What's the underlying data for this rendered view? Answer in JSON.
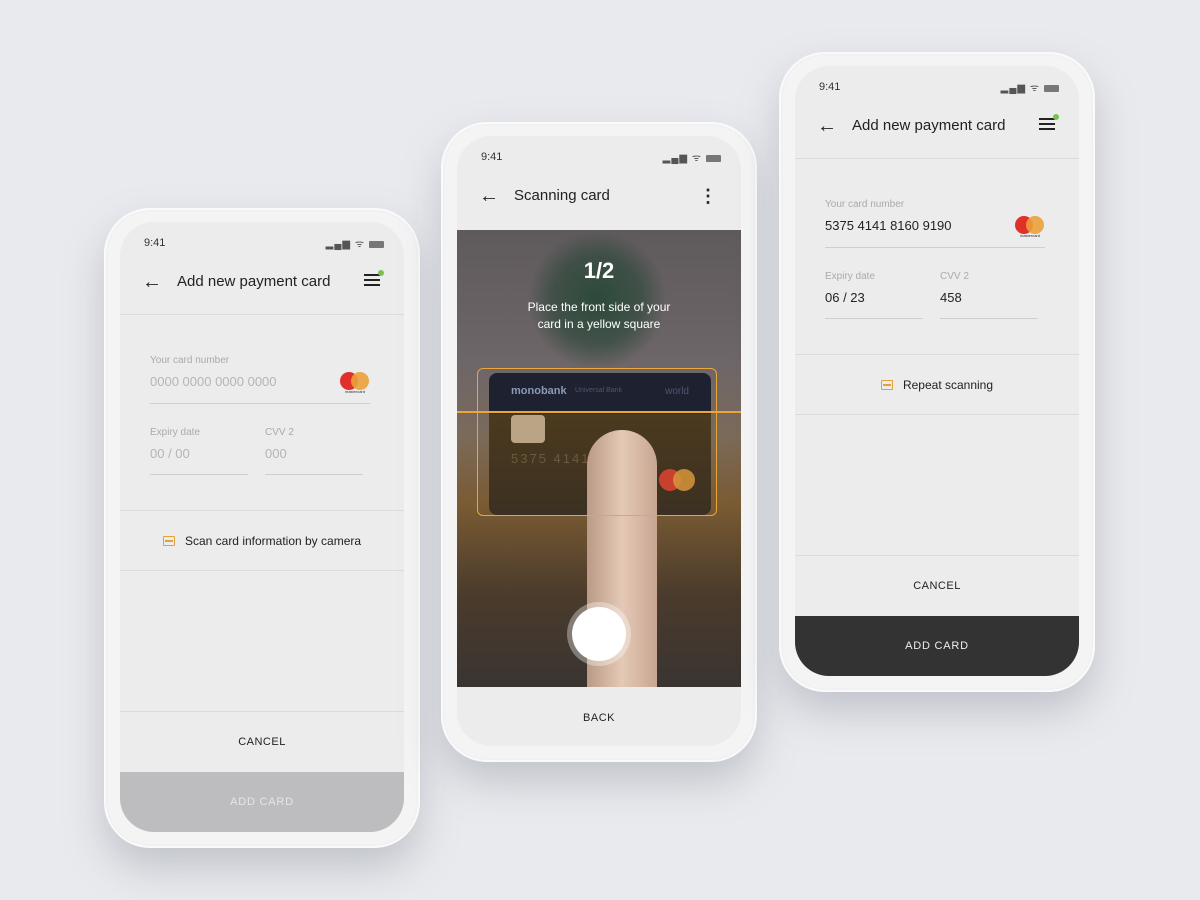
{
  "status": {
    "time": "9:41"
  },
  "form": {
    "title": "Add new payment card",
    "card_number_label": "Your card number",
    "card_number_placeholder": "0000 0000 0000 0000",
    "expiry_label": "Expiry date",
    "expiry_placeholder": "00 / 00",
    "cvv_label": "CVV 2",
    "cvv_placeholder": "000",
    "scan_label": "Scan card information by camera",
    "cancel_label": "CANCEL",
    "add_label": "ADD CARD",
    "brand": "mastercard"
  },
  "scanner": {
    "title": "Scanning card",
    "step": "1/2",
    "instruction_line1": "Place the front side of your",
    "instruction_line2": "card in a yellow square",
    "card_bank": "monobank",
    "card_sub": "Universal Bank",
    "card_tier": "world",
    "card_digits": "5375 4141   9190",
    "back_label": "BACK"
  },
  "filled": {
    "card_number": "5375 4141 8160 9190",
    "expiry": "06 / 23",
    "cvv": "458",
    "repeat_label": "Repeat scanning"
  },
  "colors": {
    "accent": "#e0a03a",
    "notification": "#7bc04f",
    "add_disabled": "#bdbdbf",
    "add_enabled": "#333333"
  }
}
